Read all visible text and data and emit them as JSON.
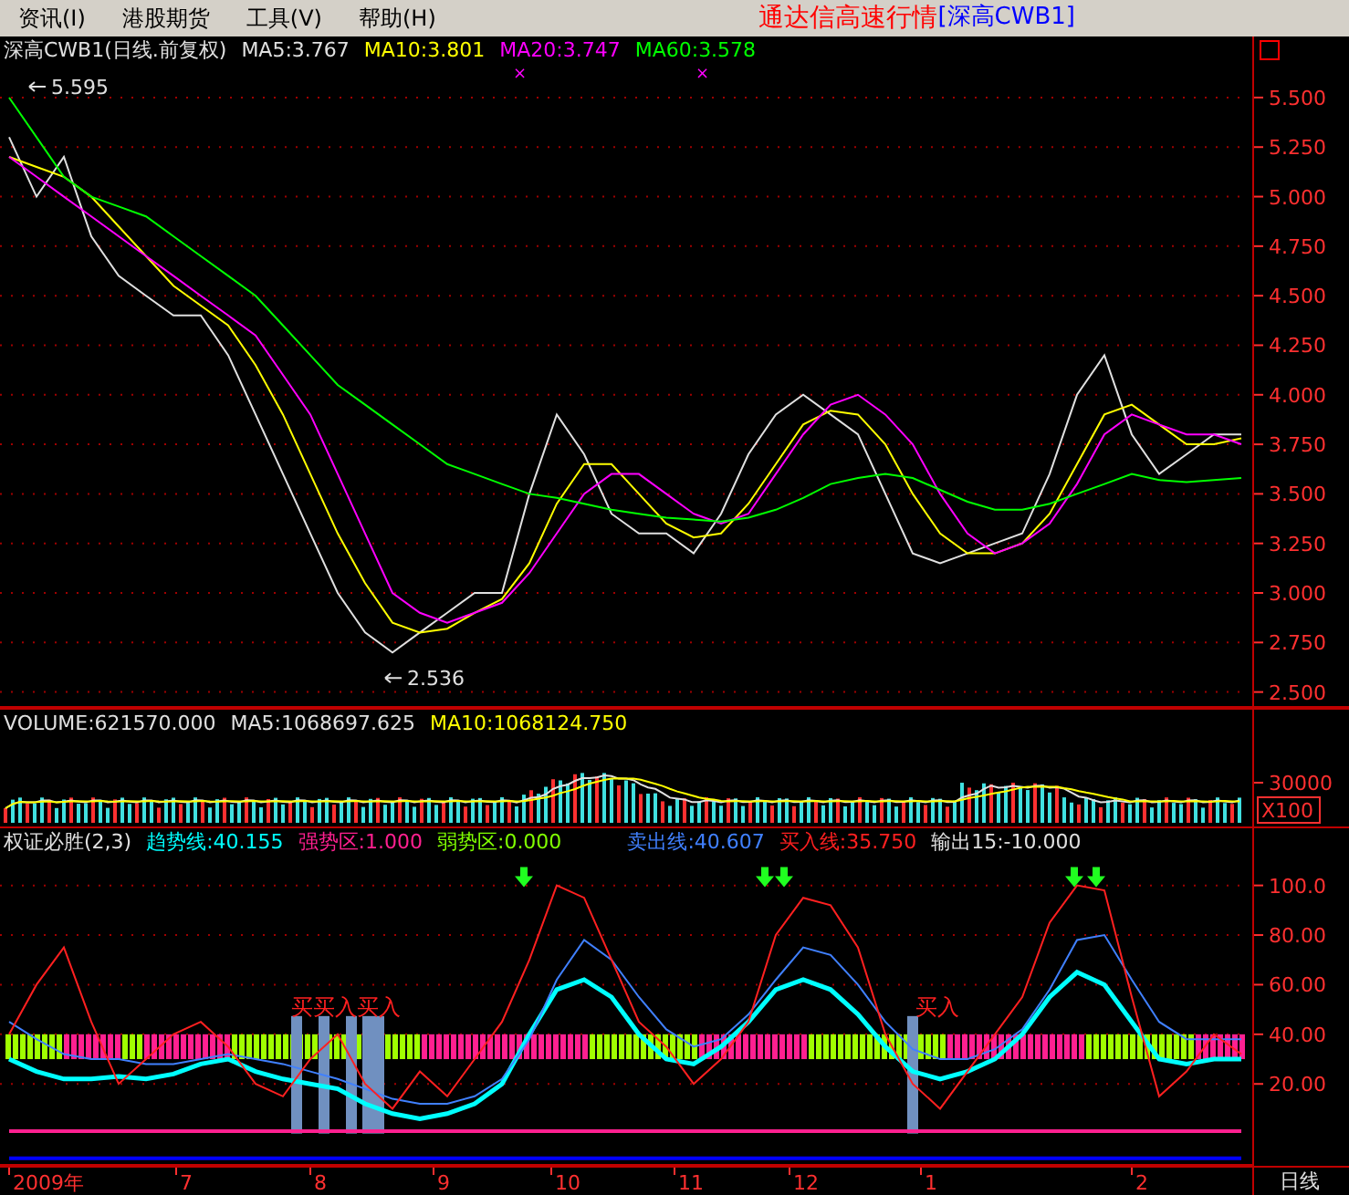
{
  "menu": {
    "items": [
      {
        "label": "资讯(I)"
      },
      {
        "label": "港股期货"
      },
      {
        "label": "工具(V)"
      },
      {
        "label": "帮助(H)"
      }
    ],
    "app_title": "通达信高速行情",
    "symbol": "[深高CWB1]"
  },
  "price_panel": {
    "legend": [
      {
        "label": "深高CWB1(日线.前复权)",
        "color": "#e0e0e0"
      },
      {
        "label": "MA5:3.767",
        "color": "#e0e0e0"
      },
      {
        "label": "MA10:3.801",
        "color": "#ffff00"
      },
      {
        "label": "MA20:3.747",
        "color": "#ff00ff"
      },
      {
        "label": "MA60:3.578",
        "color": "#00ff00"
      }
    ],
    "markers": [
      "×",
      "×"
    ],
    "chart_data": {
      "type": "line",
      "ylim": [
        2.42,
        5.67
      ],
      "grid": true,
      "yticks": [
        {
          "value": 5.5,
          "label": "5.500"
        },
        {
          "value": 5.25,
          "label": "5.250"
        },
        {
          "value": 5.0,
          "label": "5.000"
        },
        {
          "value": 4.75,
          "label": "4.750"
        },
        {
          "value": 4.5,
          "label": "4.500"
        },
        {
          "value": 4.25,
          "label": "4.250"
        },
        {
          "value": 4.0,
          "label": "4.000"
        },
        {
          "value": 3.75,
          "label": "3.750"
        },
        {
          "value": 3.5,
          "label": "3.500"
        },
        {
          "value": 3.25,
          "label": "3.250"
        },
        {
          "value": 3.0,
          "label": "3.000"
        },
        {
          "value": 2.75,
          "label": "2.750"
        },
        {
          "value": 2.5,
          "label": "2.500"
        }
      ],
      "series": [
        {
          "color": "#e0e0e0",
          "values": [
            5.3,
            5.0,
            5.2,
            4.8,
            4.6,
            4.5,
            4.4,
            4.4,
            4.2,
            3.9,
            3.6,
            3.3,
            3.0,
            2.8,
            2.7,
            2.8,
            2.9,
            3.0,
            3.0,
            3.5,
            3.9,
            3.7,
            3.4,
            3.3,
            3.3,
            3.2,
            3.4,
            3.7,
            3.9,
            4.0,
            3.9,
            3.8,
            3.5,
            3.2,
            3.15,
            3.2,
            3.25,
            3.3,
            3.6,
            4.0,
            4.2,
            3.8,
            3.6,
            3.7,
            3.8,
            3.8
          ]
        },
        {
          "color": "#ffff00",
          "values": [
            5.2,
            5.15,
            5.1,
            5.0,
            4.85,
            4.7,
            4.55,
            4.45,
            4.35,
            4.15,
            3.9,
            3.6,
            3.3,
            3.05,
            2.85,
            2.8,
            2.82,
            2.9,
            2.97,
            3.15,
            3.45,
            3.65,
            3.65,
            3.5,
            3.35,
            3.28,
            3.3,
            3.45,
            3.65,
            3.85,
            3.92,
            3.9,
            3.75,
            3.5,
            3.3,
            3.2,
            3.2,
            3.25,
            3.4,
            3.65,
            3.9,
            3.95,
            3.85,
            3.75,
            3.75,
            3.78
          ]
        },
        {
          "color": "#ff00ff",
          "values": [
            5.2,
            5.1,
            5.0,
            4.9,
            4.8,
            4.7,
            4.6,
            4.5,
            4.4,
            4.3,
            4.1,
            3.9,
            3.6,
            3.3,
            3.0,
            2.9,
            2.85,
            2.9,
            2.95,
            3.1,
            3.3,
            3.5,
            3.6,
            3.6,
            3.5,
            3.4,
            3.35,
            3.4,
            3.6,
            3.8,
            3.95,
            4.0,
            3.9,
            3.75,
            3.5,
            3.3,
            3.2,
            3.25,
            3.35,
            3.55,
            3.8,
            3.9,
            3.85,
            3.8,
            3.8,
            3.75
          ]
        },
        {
          "color": "#00ff00",
          "values": [
            5.5,
            5.3,
            5.1,
            5.0,
            4.95,
            4.9,
            4.8,
            4.7,
            4.6,
            4.5,
            4.35,
            4.2,
            4.05,
            3.95,
            3.85,
            3.75,
            3.65,
            3.6,
            3.55,
            3.5,
            3.48,
            3.45,
            3.42,
            3.4,
            3.38,
            3.37,
            3.36,
            3.38,
            3.42,
            3.48,
            3.55,
            3.58,
            3.6,
            3.58,
            3.52,
            3.46,
            3.42,
            3.42,
            3.45,
            3.5,
            3.55,
            3.6,
            3.57,
            3.56,
            3.57,
            3.58
          ]
        }
      ],
      "annotations": [
        "5.595",
        "2.536"
      ]
    }
  },
  "volume_panel": {
    "legend": [
      {
        "label": "VOLUME:621570.000",
        "color": "#e0e0e0"
      },
      {
        "label": "MA5:1068697.625",
        "color": "#e0e0e0"
      },
      {
        "label": "MA10:1068124.750",
        "color": "#ffff00"
      }
    ],
    "axis_label": "30000",
    "multiplier": "X100"
  },
  "indicator_panel": {
    "legend": [
      {
        "label": "权证必胜(2,3)",
        "color": "#e0e0e0"
      },
      {
        "label": "趋势线:40.155",
        "color": "#00ffff"
      },
      {
        "label": "强势区:1.000",
        "color": "#ff2090"
      },
      {
        "label": "弱势区:0.000",
        "color": "#80ff00"
      },
      {
        "label": "卖出线:40.607",
        "color": "#4080ff"
      },
      {
        "label": "买入线:35.750",
        "color": "#ff2020"
      },
      {
        "label": "输出15:-10.000",
        "color": "#e0e0e0"
      }
    ],
    "chart_data": {
      "type": "line",
      "ylim": [
        -13,
        112
      ],
      "grid": true,
      "yticks": [
        {
          "value": 100,
          "label": "100.0"
        },
        {
          "value": 80,
          "label": "80.00"
        },
        {
          "value": 60,
          "label": "60.00"
        },
        {
          "value": 40,
          "label": "40.00"
        },
        {
          "value": 20,
          "label": "20.00"
        }
      ],
      "series": [
        {
          "color": "#00ffff",
          "values": [
            30,
            25,
            22,
            22,
            23,
            22,
            24,
            28,
            30,
            25,
            22,
            20,
            18,
            12,
            8,
            6,
            8,
            12,
            20,
            40,
            58,
            62,
            55,
            40,
            30,
            28,
            35,
            45,
            58,
            62,
            58,
            48,
            35,
            25,
            22,
            25,
            30,
            40,
            55,
            65,
            60,
            45,
            30,
            28,
            30,
            30
          ]
        },
        {
          "color": "#4080ff",
          "values": [
            45,
            38,
            32,
            30,
            30,
            28,
            28,
            30,
            32,
            30,
            28,
            25,
            22,
            18,
            14,
            12,
            12,
            15,
            22,
            38,
            62,
            78,
            70,
            55,
            42,
            35,
            38,
            48,
            62,
            75,
            72,
            60,
            45,
            34,
            30,
            30,
            34,
            42,
            58,
            78,
            80,
            62,
            45,
            38,
            38,
            38
          ]
        },
        {
          "color": "#ff2020",
          "values": [
            40,
            60,
            75,
            45,
            20,
            30,
            40,
            45,
            35,
            20,
            15,
            30,
            40,
            20,
            10,
            25,
            15,
            30,
            45,
            70,
            100,
            95,
            70,
            45,
            35,
            20,
            30,
            45,
            80,
            95,
            92,
            75,
            40,
            20,
            10,
            25,
            40,
            55,
            85,
            100,
            98,
            55,
            15,
            25,
            40,
            32
          ]
        },
        {
          "color": "#ff2090",
          "values": [
            1,
            1,
            1,
            1,
            1,
            1,
            1,
            1,
            1,
            1,
            1,
            1,
            1,
            1,
            1,
            1,
            1,
            1,
            1,
            1,
            1,
            1,
            1,
            1,
            1,
            1,
            1,
            1,
            1,
            1,
            1,
            1,
            1,
            1,
            1,
            1,
            1,
            1,
            1,
            1,
            1,
            1,
            1,
            1,
            1,
            1
          ]
        },
        {
          "color": "#0000ff",
          "values": [
            -10,
            -10,
            -10,
            -10,
            -10,
            -10,
            -10,
            -10,
            -10,
            -10,
            -10,
            -10,
            -10,
            -10,
            -10,
            -10,
            -10,
            -10,
            -10,
            -10,
            -10,
            -10,
            -10,
            -10,
            -10,
            -10,
            -10,
            -10,
            -10,
            -10,
            -10,
            -10,
            -10,
            -10,
            -10,
            -10,
            -10,
            -10,
            -10,
            -10,
            -10,
            -10,
            -10,
            -10,
            -10,
            -10
          ]
        }
      ],
      "annotations": [
        "买买入买入",
        "买入"
      ]
    }
  },
  "x_axis": {
    "labels": [
      "2009年",
      "7",
      "8",
      "9",
      "10",
      "11",
      "12",
      "1",
      "2"
    ]
  },
  "timeframe": "日线"
}
